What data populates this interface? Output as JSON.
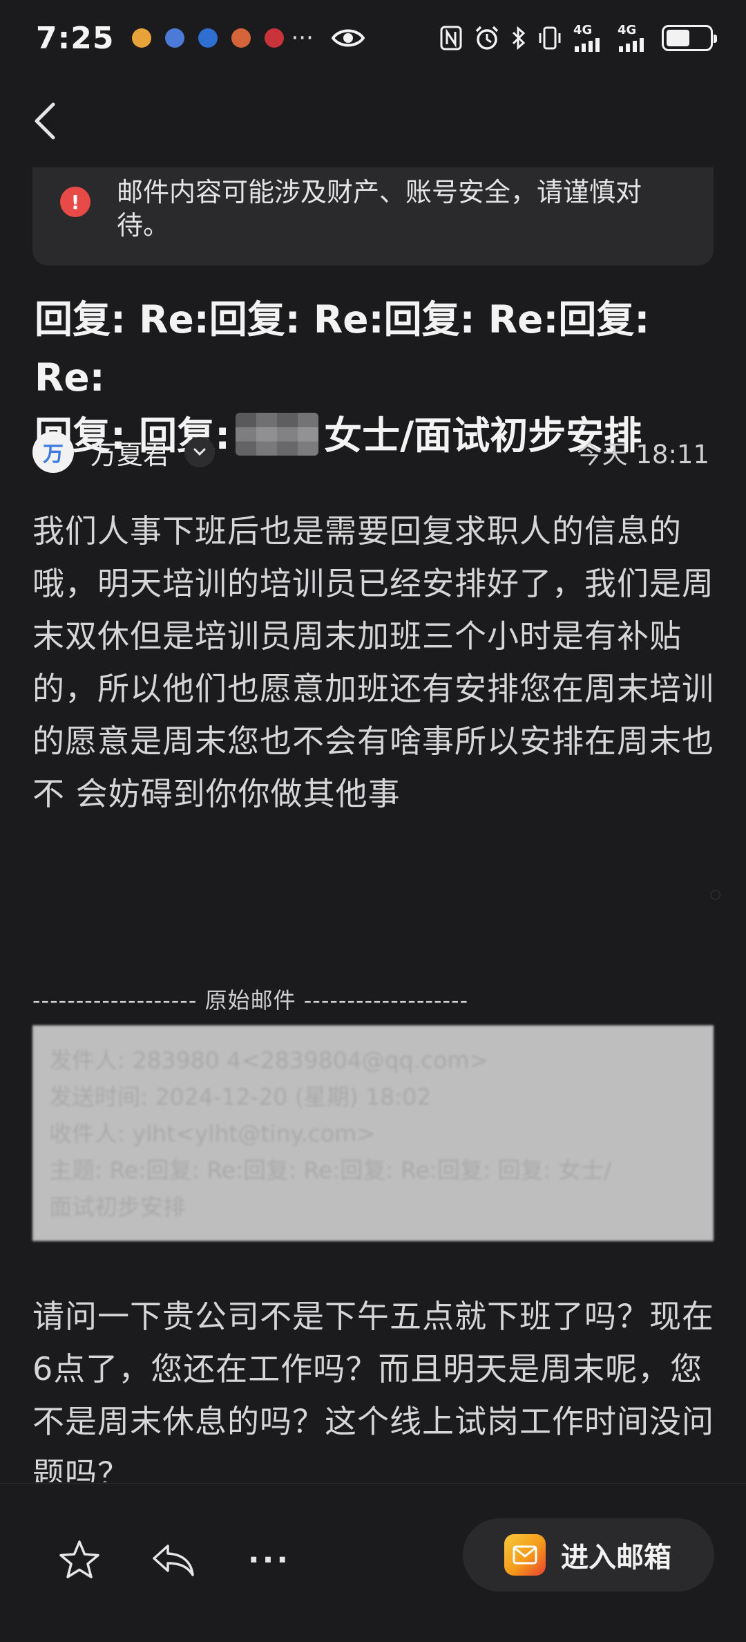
{
  "status_bar": {
    "time": "7:25",
    "more": "···",
    "net1": "4G",
    "net2": "4G",
    "battery_level": 0.55,
    "notification_colors": [
      "#e8a23a",
      "#4b7bd6",
      "#2f6fd1",
      "#d4653a",
      "#c9343a"
    ]
  },
  "warning": {
    "text": "邮件内容可能涉及财产、账号安全，请谨慎对待。",
    "color": "#e84a47"
  },
  "subject": {
    "part1": "回复: Re:回复: Re:回复: Re:回复: Re:",
    "part2": "回复: 回复:",
    "part3": "女士/面试初步安排"
  },
  "sender": {
    "avatar_letter": "万",
    "name": "万夏君",
    "time": "今天 18:11"
  },
  "body": {
    "text": "我们人事下班后也是需要回复求职人的信息的哦，明天培训的培训员已经安排好了，我们是周末双休但是培训员周末加班三个小时是有补贴的，所以他们也愿意加班还有安排您在周末培训的愿意是周末您也不会有啥事所以安排在周末也不 会妨碍到你你做其他事"
  },
  "original": {
    "divider": "------------------- 原始邮件 -------------------",
    "lines": [
      "发件人: 283980 4<2839804@qq.com>",
      "发送时间: 2024-12-20 (星期) 18:02",
      "收件人: ylht<ylht@tiny.com>",
      "主题: Re:回复: Re:回复: Re:回复: Re:回复: 回复: 女士/",
      "面试初步安排"
    ]
  },
  "reply": {
    "text": "请问一下贵公司不是下午五点就下班了吗？现在6点了，您还在工作吗？而且明天是周末呢，您不是周末休息的吗？这个线上试岗工作时间没问题吗？"
  },
  "bottom_bar": {
    "more": "···",
    "open_mailbox": "进入邮箱"
  }
}
